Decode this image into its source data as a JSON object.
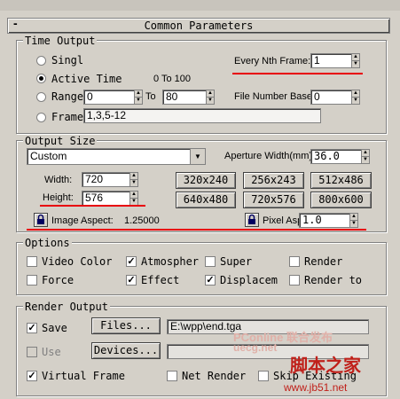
{
  "rollout": {
    "title": "Common Parameters",
    "collapse_symbol": "-"
  },
  "time_output": {
    "group_label": "Time Output",
    "single_label": "Singl",
    "active_time_label": "Active Time",
    "active_time_range": "0 To 100",
    "range_label": "Range",
    "range_from": "0",
    "range_to_label": "To",
    "range_to": "80",
    "frames_label": "Frame",
    "frames_value": "1,3,5-12",
    "every_nth_label": "Every Nth Frame:",
    "every_nth_value": "1",
    "file_number_base_label": "File Number Base:",
    "file_number_base_value": "0",
    "selected": "active_time"
  },
  "output_size": {
    "group_label": "Output Size",
    "preset": "Custom",
    "aperture_label": "Aperture Width(mm):",
    "aperture_value": "36.0",
    "width_label": "Width:",
    "width_value": "720",
    "height_label": "Height:",
    "height_value": "576",
    "presets": [
      "320x240",
      "256x243",
      "512x486",
      "640x480",
      "720x576",
      "800x600"
    ],
    "image_aspect_label": "Image Aspect:",
    "image_aspect_value": "1.25000",
    "pixel_aspect_label": "Pixel Aspect:",
    "pixel_aspect_value": "1.0"
  },
  "options": {
    "group_label": "Options",
    "items": [
      {
        "label": "Video Color",
        "checked": false
      },
      {
        "label": "Atmospher",
        "checked": true
      },
      {
        "label": "Super",
        "checked": false
      },
      {
        "label": "Render",
        "checked": false
      },
      {
        "label": "Force",
        "checked": false
      },
      {
        "label": "Effect",
        "checked": true
      },
      {
        "label": "Displacem",
        "checked": true
      },
      {
        "label": "Render to",
        "checked": false
      }
    ]
  },
  "render_output": {
    "group_label": "Render Output",
    "save_label": "Save",
    "save_checked": true,
    "files_button": "Files...",
    "file_path": "E:\\wpp\\end.tga",
    "use_label": "Use",
    "devices_button": "Devices...",
    "virtual_frame_label": "Virtual Frame",
    "virtual_frame_checked": true,
    "net_render_label": "Net Render",
    "skip_existing_label": "Skip Existing"
  },
  "watermark": {
    "line1": "PConline 联合发布",
    "line2": "uecg.net",
    "line3": "脚本之家",
    "line4": "www.jb51.net"
  },
  "colors": {
    "annotation_red": "#e8000b",
    "panel_gray": "#d4d0c8"
  }
}
